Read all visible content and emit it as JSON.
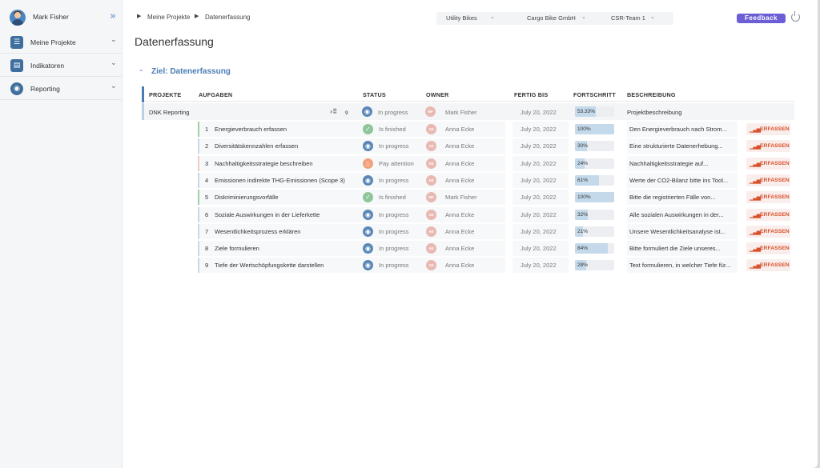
{
  "user": {
    "name": "Mark Fisher"
  },
  "sidebar": {
    "items": [
      {
        "label": "Meine Projekte",
        "icon": "checklist-icon"
      },
      {
        "label": "Indikatoren",
        "icon": "clipboard-icon"
      },
      {
        "label": "Reporting",
        "icon": "globe-icon"
      }
    ]
  },
  "breadcrumb": [
    "Meine Projekte",
    "Datenerfassung"
  ],
  "filters": [
    "Utility Bikes",
    "Cargo Bike GmbH",
    "CSR-Team 1"
  ],
  "feedback_label": "Feedback",
  "page_title": "Datenerfassung",
  "goal_title": "Ziel: Datenerfassung",
  "columns": {
    "projekte": "PROJEKTE",
    "aufgaben": "AUFGABEN",
    "status": "STATUS",
    "owner": "OWNER",
    "fertig_bis": "FERTIG BIS",
    "fortschritt": "FORTSCHRITT",
    "beschreibung": "BESCHREIBUNG"
  },
  "project": {
    "name": "DNK Reporting",
    "subtask_count": "9",
    "status": "In progress",
    "owner_initials": "MF",
    "owner": "Mark Fisher",
    "due": "July 20, 2022",
    "progress_label": "53.33%",
    "progress": 0.5333,
    "description": "Projektbeschreibung"
  },
  "capture_label": "ERFASSEN",
  "status_colors": {
    "in_progress": "#5a87b8",
    "finished": "#8fc59a",
    "attention": "#f2a07a"
  },
  "tasks": [
    {
      "num": "1",
      "name": "Energieverbrauch erfassen",
      "status": "Is finished",
      "status_type": "finished",
      "owner_initials": "AE",
      "owner": "Anna Ecke",
      "due": "July 20, 2022",
      "progress_label": "100%",
      "progress": 1.0,
      "description": "Den Energieverbrauch nach Strom...",
      "bar_color": "#9fd0a8"
    },
    {
      "num": "2",
      "name": "Diversitätskennzahlen erfassen",
      "status": "In progress",
      "status_type": "in_progress",
      "owner_initials": "AE",
      "owner": "Anna Ecke",
      "due": "July 20, 2022",
      "progress_label": "30%",
      "progress": 0.3,
      "description": "Eine strukturierte Datenerhebung...",
      "bar_color": "#c8d8e8"
    },
    {
      "num": "3",
      "name": "Nachhaltigkeitsstrategie beschreiben",
      "status": "Pay attention",
      "status_type": "attention",
      "owner_initials": "AE",
      "owner": "Anna Ecke",
      "due": "July 20, 2022",
      "progress_label": "24%",
      "progress": 0.24,
      "description": "Nachhaltigkeitsstrategie auf...",
      "bar_color": "#f2c9c4"
    },
    {
      "num": "4",
      "name": "Emissionen indirekte THG-Emissionen (Scope 3)",
      "status": "In progress",
      "status_type": "in_progress",
      "owner_initials": "AE",
      "owner": "Anna Ecke",
      "due": "July 20, 2022",
      "progress_label": "61%",
      "progress": 0.61,
      "description": "Werte der CO2-Bilanz bitte ins Tool...",
      "bar_color": "#c8d8e8"
    },
    {
      "num": "5",
      "name": "Diskriminierungsvorfälle",
      "status": "Is finished",
      "status_type": "finished",
      "owner_initials": "MF",
      "owner": "Mark Fisher",
      "due": "July 20, 2022",
      "progress_label": "100%",
      "progress": 1.0,
      "description": "Bitte die registrierten Fälle von...",
      "bar_color": "#9fd0a8"
    },
    {
      "num": "6",
      "name": "Soziale Auswirkungen in der Lieferkette",
      "status": "In progress",
      "status_type": "in_progress",
      "owner_initials": "AE",
      "owner": "Anna Ecke",
      "due": "July 20, 2022",
      "progress_label": "32%",
      "progress": 0.32,
      "description": "Alle sozialen Auswirkungen in der...",
      "bar_color": "#c8d8e8"
    },
    {
      "num": "7",
      "name": "Wesentlichkeitsprozess erklären",
      "status": "In progress",
      "status_type": "in_progress",
      "owner_initials": "AE",
      "owner": "Anna Ecke",
      "due": "July 20, 2022",
      "progress_label": "21%",
      "progress": 0.21,
      "description": "Unsere Wesentlichkeitsanalyse ist...",
      "bar_color": "#c8d8e8"
    },
    {
      "num": "8",
      "name": "Ziele formulieren",
      "status": "In progress",
      "status_type": "in_progress",
      "owner_initials": "AE",
      "owner": "Anna Ecke",
      "due": "July 20, 2022",
      "progress_label": "84%",
      "progress": 0.84,
      "description": "Bitte formuliert die Ziele unseres...",
      "bar_color": "#c8d8e8"
    },
    {
      "num": "9",
      "name": "Tiefe der Wertschöpfungskette darstellen",
      "status": "In progress",
      "status_type": "in_progress",
      "owner_initials": "AE",
      "owner": "Anna Ecke",
      "due": "July 20, 2022",
      "progress_label": "28%",
      "progress": 0.28,
      "description": "Text formulieren, in welcher Tiefe für...",
      "bar_color": "#c8d8e8"
    }
  ]
}
